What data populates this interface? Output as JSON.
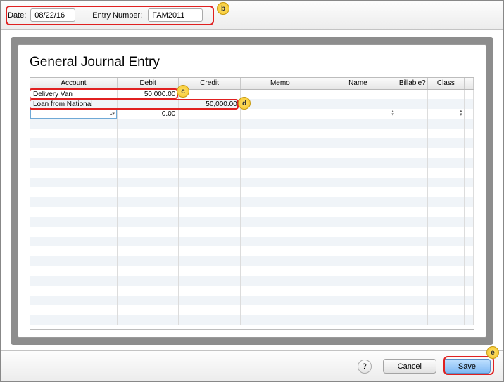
{
  "topbar": {
    "date_label": "Date:",
    "date_value": "08/22/16",
    "entry_label": "Entry Number:",
    "entry_value": "FAM2011"
  },
  "panel": {
    "title": "General Journal Entry"
  },
  "columns": {
    "account": "Account",
    "debit": "Debit",
    "credit": "Credit",
    "memo": "Memo",
    "name": "Name",
    "billable": "Billable?",
    "class": "Class"
  },
  "rows": [
    {
      "account": "Delivery Van",
      "debit": "50,000.00",
      "credit": "",
      "memo": "",
      "name": "",
      "billable": "",
      "class": ""
    },
    {
      "account": "Loan from National",
      "debit": "",
      "credit": "50,000.00",
      "memo": "",
      "name": "",
      "billable": "",
      "class": ""
    }
  ],
  "active_row": {
    "debit": "0.00"
  },
  "bottombar": {
    "help": "?",
    "cancel": "Cancel",
    "save": "Save"
  },
  "callouts": {
    "b": "b",
    "c": "c",
    "d": "d",
    "e": "e"
  }
}
